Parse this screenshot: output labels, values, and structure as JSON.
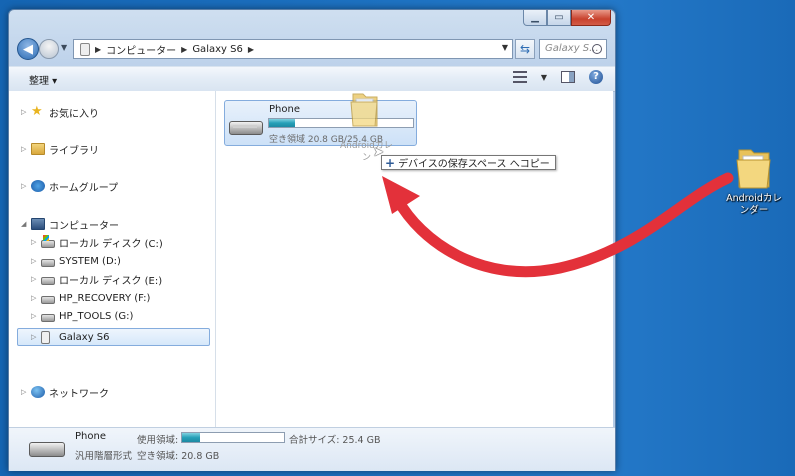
{
  "window": {
    "address": {
      "seg1": "コンピューター",
      "seg2": "Galaxy S6"
    },
    "search_placeholder": "Galaxy S...",
    "toolbar": {
      "organize": "整理 ▾"
    }
  },
  "nav_pane": {
    "favorites": "お気に入り",
    "libraries": "ライブラリ",
    "homegroup": "ホームグループ",
    "computer": "コンピューター",
    "drives": [
      "ローカル ディスク (C:)",
      "SYSTEM (D:)",
      "ローカル ディスク (E:)",
      "HP_RECOVERY (F:)",
      "HP_TOOLS (G:)"
    ],
    "device": "Galaxy S6",
    "network": "ネットワーク"
  },
  "content": {
    "tile": {
      "name": "Phone",
      "free_text": "空き領域 20.8 GB/25.4 GB",
      "used_fraction": 0.18
    },
    "drag_label_line1": "Androidカレ",
    "drag_label_line2": "ン",
    "tooltip_text": "デバイスの保存スペース へコピー"
  },
  "status_bar": {
    "name": "Phone",
    "filesystem": "汎用階層形式",
    "used_label": "使用領域:",
    "total": "合計サイズ: 25.4 GB",
    "free": "空き領域: 20.8 GB",
    "used_fraction": 0.18
  },
  "desktop": {
    "folder_label": "Androidカレンダー"
  },
  "colors": {
    "desktop": "#1f74c4",
    "arrow": "#e3313a",
    "bar_fill": "#26a0b8",
    "selection": "#d6e8fa"
  },
  "icons": {
    "favorites": "star-icon",
    "libraries": "library-icon",
    "homegroup": "homegroup-icon",
    "computer": "computer-icon",
    "drive": "drive-icon",
    "device": "phone-icon",
    "network": "network-icon"
  }
}
